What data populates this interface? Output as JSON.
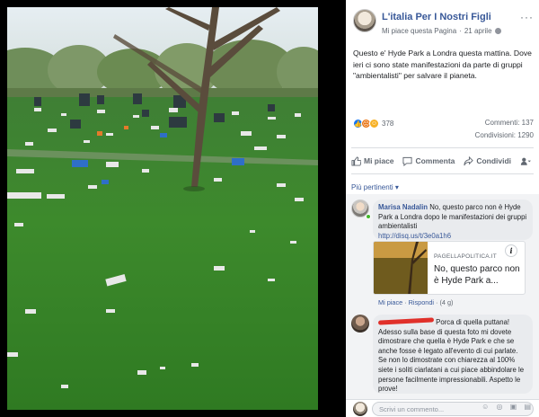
{
  "post": {
    "page_name": "L'italia Per I Nostri Figli",
    "like_page": "Mi piace questa Pagina",
    "date": "21 aprile",
    "more": "···",
    "text": "Questo e' Hyde Park a Londra questa mattina. Dove ieri ci sono state manifestazioni da parte di gruppi \"ambientalisti\" per salvare il pianeta.",
    "reaction_count": "378",
    "comments_count": "Commenti: 137",
    "shares_count": "Condivisioni: 1290"
  },
  "actions": {
    "like": "Mi piace",
    "comment": "Commenta",
    "share": "Condividi"
  },
  "filter": "Più pertinenti ▾",
  "comments": [
    {
      "author": "Marisa Nadalin",
      "text": "No, questo parco non è Hyde Park a Londra dopo le manifestazioni dei gruppi ambientalisti",
      "link": "http://disq.us/t/3e0a1h6",
      "card_source": "PAGELLAPOLITICA.IT",
      "card_title": "No, questo parco non è Hyde Park a...",
      "like": "Mi piace",
      "reply": "Rispondi",
      "time": "(4 g)"
    },
    {
      "author_redacted": true,
      "text": "Porca di quella puttana! Adesso sulla base di questa foto mi dovete dimostrare che quella è Hyde Park e che se anche fosse è legato all'evento di cui parlate. Se non lo dimostrate con chiarezza al 100% siete i soliti ciarlatani a cui piace abbindolare le persone facilmente impressionabili. Aspetto le prove!"
    }
  ],
  "write_comment": {
    "placeholder": "Scrivi un commento...",
    "icons": "☺ ◎ ▣ ▤"
  },
  "colors": {
    "link_blue": "#385898",
    "grass": "#3f8a2a",
    "redaction": "#e0302a"
  }
}
